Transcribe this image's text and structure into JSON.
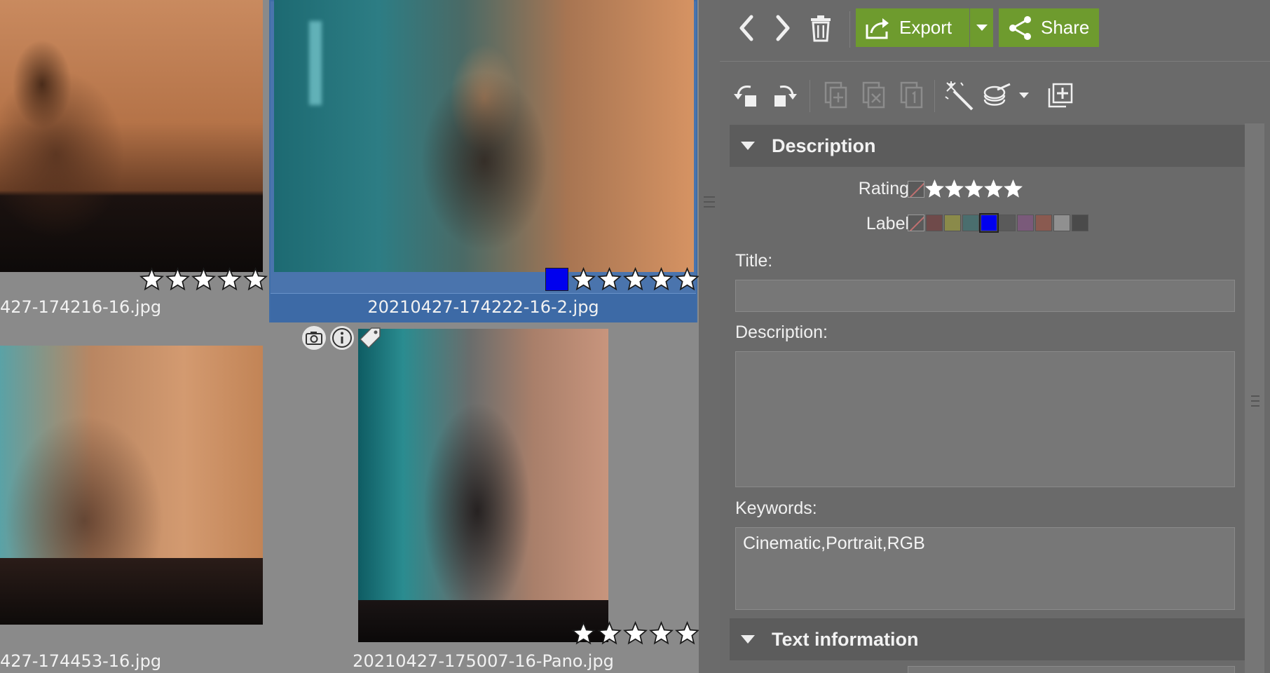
{
  "browser": {
    "thumbnails": [
      {
        "filename": "427-174216-16.jpg",
        "rating": 5,
        "selected": false
      },
      {
        "filename": "20210427-174222-16-2.jpg",
        "rating": 5,
        "selected": true,
        "color_label": "#0000ee"
      },
      {
        "filename": "427-174453-16.jpg",
        "rating": 0,
        "selected": false
      },
      {
        "filename": "20210427-175007-16-Pano.jpg",
        "rating": 5,
        "selected": false
      }
    ],
    "overlay_icons": [
      "camera-icon",
      "info-icon",
      "tag-icon"
    ]
  },
  "toolbar": {
    "back_icon": "chevron-left-icon",
    "forward_icon": "chevron-right-icon",
    "delete_icon": "trash-icon",
    "export_label": "Export",
    "share_label": "Share",
    "accent": "#6e9b2e"
  },
  "toolbar2": {
    "icons": [
      "rotate-left-icon",
      "rotate-right-icon",
      "copy-icon",
      "remove-icon",
      "page-icon",
      "magic-wand-icon",
      "layers-icon",
      "add-page-icon"
    ]
  },
  "description_section": {
    "title": "Description",
    "rating_label": "Rating:",
    "label_label": "Label:",
    "label_colors": [
      "#6f4a4a",
      "#8a8a4a",
      "#4a6e6e",
      "#0000ee",
      "#5a5a5a",
      "#7a5a7a",
      "#8a5a50",
      "#909090",
      "#4a4a4a"
    ],
    "selected_label_index": 3,
    "title_label": "Title:",
    "title_value": "",
    "description_label": "Description:",
    "description_value": "",
    "keywords_label": "Keywords:",
    "keywords_value": "Cinematic,Portrait,RGB"
  },
  "text_info_section": {
    "title": "Text information"
  }
}
